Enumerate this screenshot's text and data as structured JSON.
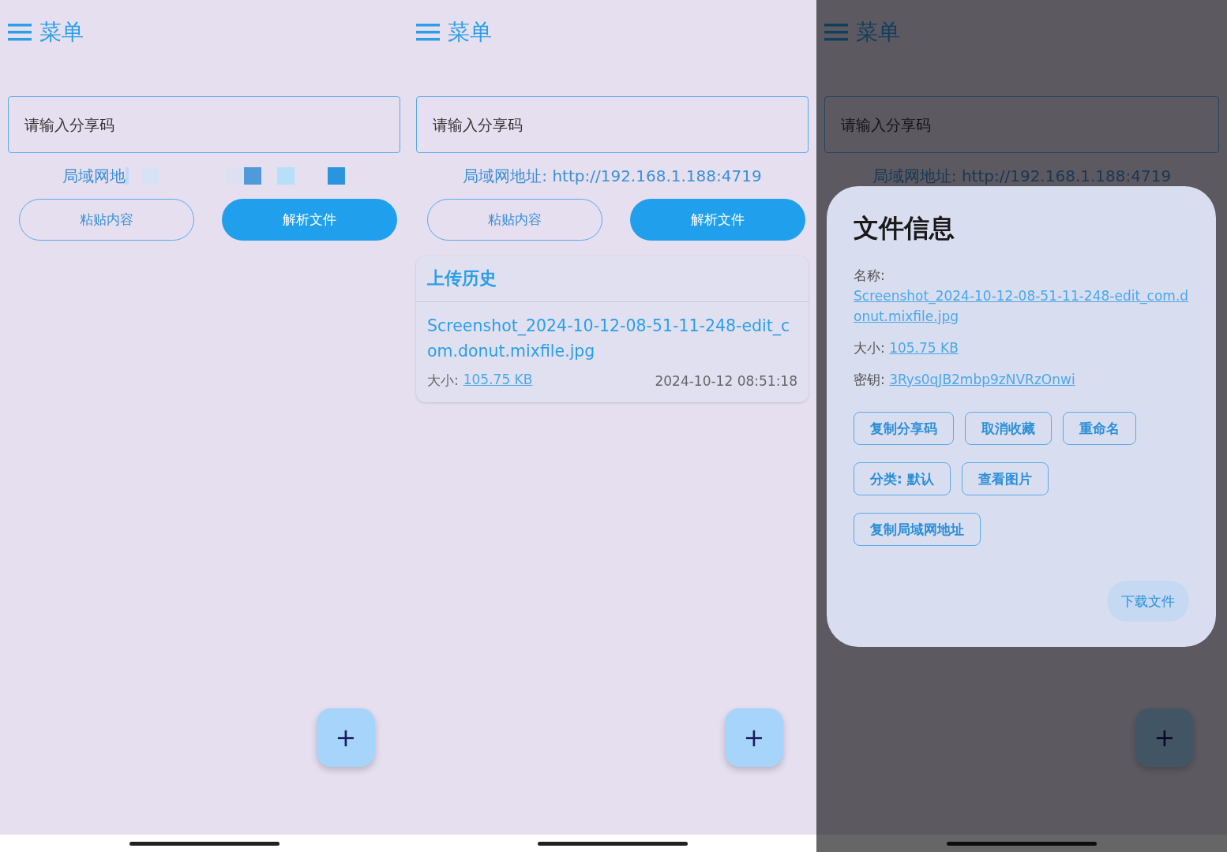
{
  "screens": [
    {
      "menu_label": "菜单",
      "search": {
        "placeholder": "请输入分享码"
      },
      "lan_address": "局域网地",
      "lan_address_obscured": true,
      "buttons": [
        {
          "label": "粘贴内容",
          "kind": "outlined"
        },
        {
          "label": "解析文件",
          "kind": "filled"
        }
      ],
      "fab": "+",
      "dimmed": false
    },
    {
      "menu_label": "菜单",
      "search": {
        "placeholder": "请输入分享码"
      },
      "lan_address": "局域网地址: http://192.168.1.188:4719",
      "lan_address_obscured": false,
      "buttons": [
        {
          "label": "粘贴内容",
          "kind": "outlined"
        },
        {
          "label": "解析文件",
          "kind": "filled"
        }
      ],
      "history": {
        "title": "上传历史",
        "items": [
          {
            "name": "Screenshot_2024-10-12-08-51-11-248-edit_com.donut.mixfile.jpg",
            "size_label": "大小:",
            "size": "105.75 KB",
            "time": "2024-10-12 08:51:18"
          }
        ]
      },
      "fab": "+",
      "dimmed": false
    },
    {
      "menu_label": "菜单",
      "search": {
        "placeholder": "请输入分享码"
      },
      "lan_address": "局域网地址: http://192.168.1.188:4719",
      "lan_address_obscured": false,
      "fab": "+",
      "dimmed": true,
      "dialog": {
        "title": "文件信息",
        "fields": [
          {
            "label": "名称:",
            "value": "Screenshot_2024-10-12-08-51-11-248-edit_com.donut.mixfile.jpg",
            "kind": "block"
          },
          {
            "label": "大小:",
            "value": "105.75 KB",
            "kind": "inline"
          },
          {
            "label": "密钥:",
            "value": "3Rys0qJB2mbp9zNVRzOnwi",
            "kind": "inline"
          }
        ],
        "actions": [
          [
            "复制分享码",
            "取消收藏",
            "重命名"
          ],
          [
            "分类: 默认",
            "查看图片"
          ],
          [
            "复制局域网地址"
          ]
        ],
        "confirm": "下载文件"
      }
    }
  ]
}
